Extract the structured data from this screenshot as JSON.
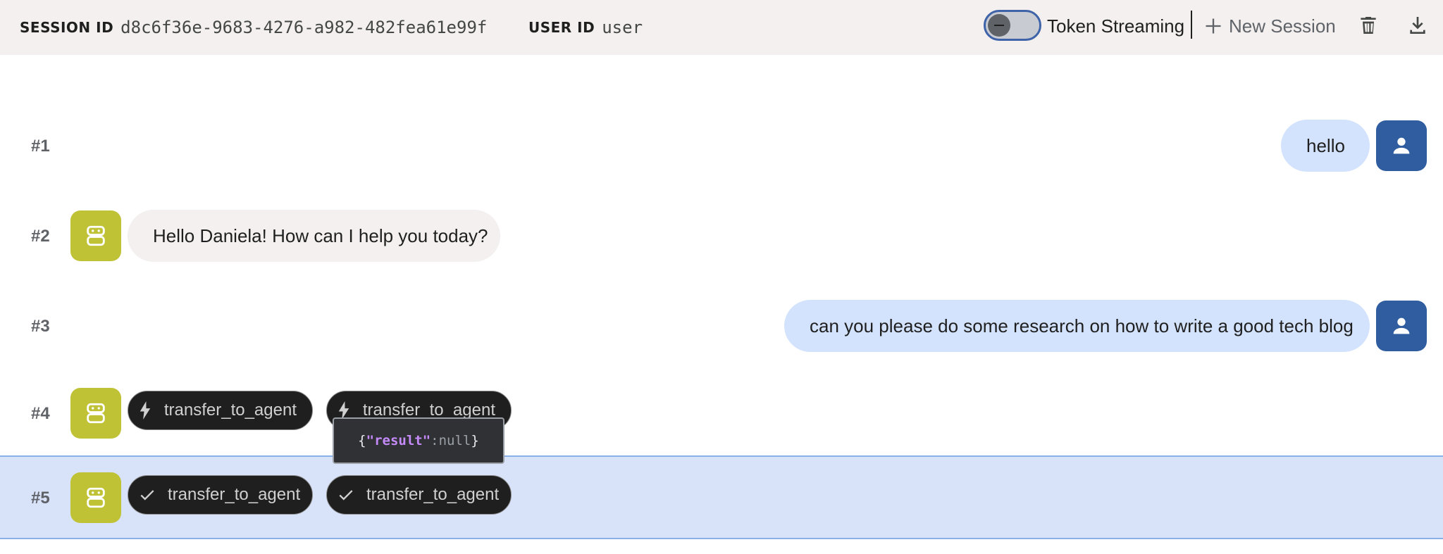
{
  "header": {
    "session_label": "SESSION ID",
    "session_value": "d8c6f36e-9683-4276-a982-482fea61e99f",
    "user_label": "USER ID",
    "user_value": "user",
    "streaming_label": "Token Streaming",
    "new_session_label": "New Session",
    "streaming_enabled": false
  },
  "messages": [
    {
      "num": "#1",
      "role": "user",
      "text": "hello"
    },
    {
      "num": "#2",
      "role": "bot",
      "text": "Hello Daniela! How can I help you today?"
    },
    {
      "num": "#3",
      "role": "user",
      "text": "can you please do some research on how to write a good tech blog"
    },
    {
      "num": "#4",
      "role": "bot",
      "chips": [
        {
          "icon": "bolt-icon",
          "label": "transfer_to_agent"
        },
        {
          "icon": "bolt-icon",
          "label": "transfer_to_agent"
        }
      ]
    },
    {
      "num": "#5",
      "role": "bot",
      "selected": true,
      "chips": [
        {
          "icon": "check-icon",
          "label": "transfer_to_agent"
        },
        {
          "icon": "check-icon",
          "label": "transfer_to_agent"
        }
      ]
    }
  ],
  "tooltip": {
    "open": "{",
    "key": "\"result\"",
    "colon": ":",
    "value": "null",
    "close": "}"
  },
  "colors": {
    "bot_avatar": "#c0c236",
    "user_avatar": "#2f5da0",
    "user_bubble": "#d3e3fd",
    "selected_row": "#d8e3fa"
  }
}
